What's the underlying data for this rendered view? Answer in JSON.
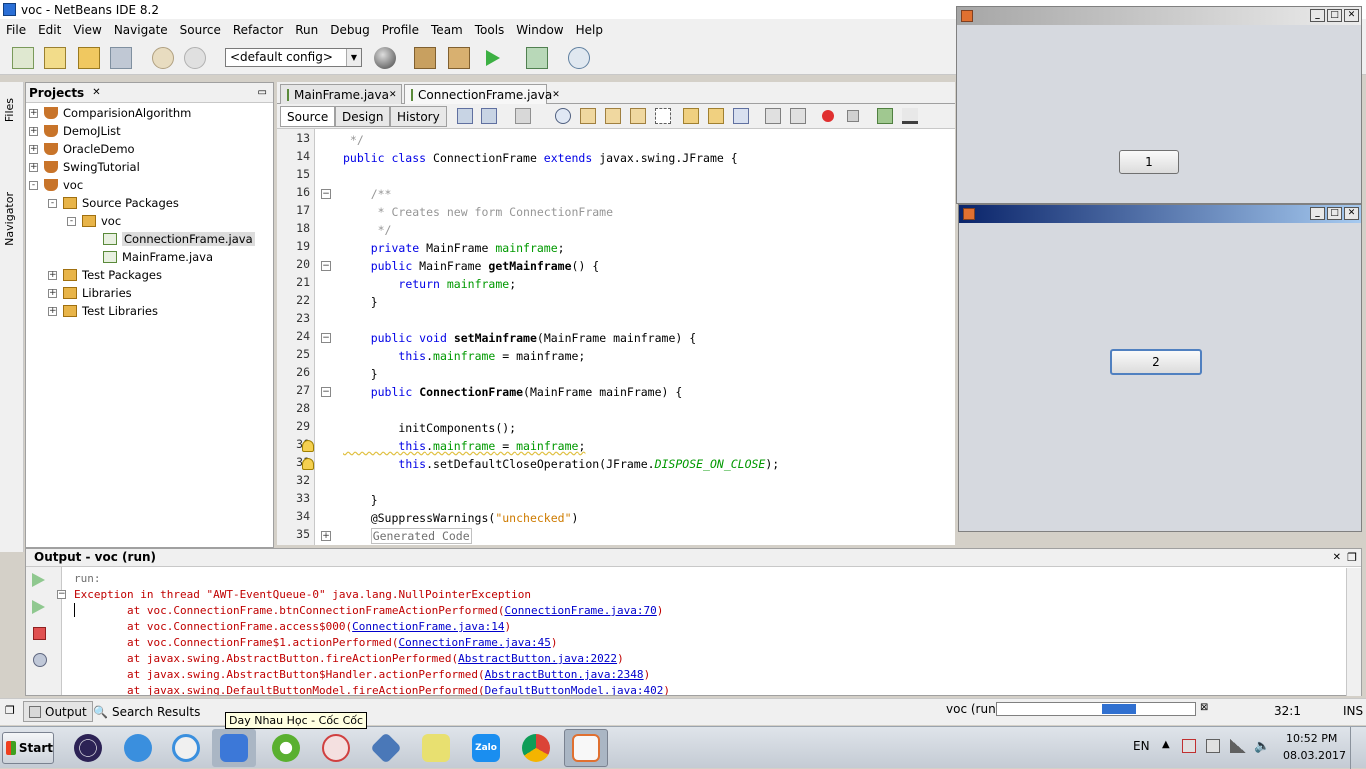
{
  "window": {
    "title": "voc - NetBeans IDE 8.2"
  },
  "menu": [
    "File",
    "Edit",
    "View",
    "Navigate",
    "Source",
    "Refactor",
    "Run",
    "Debug",
    "Profile",
    "Team",
    "Tools",
    "Window",
    "Help"
  ],
  "toolbar": {
    "config": "<default config>"
  },
  "side_tabs": {
    "files": "Files",
    "navigator": "Navigator"
  },
  "projects": {
    "title": "Projects",
    "items": [
      {
        "label": "ComparisionAlgorithm",
        "exp": "+"
      },
      {
        "label": "DemoJList",
        "exp": "+"
      },
      {
        "label": "OracleDemo",
        "exp": "+"
      },
      {
        "label": "SwingTutorial",
        "exp": "+"
      },
      {
        "label": "voc",
        "exp": "-"
      },
      {
        "label": "Source Packages",
        "exp": "-"
      },
      {
        "label": "voc",
        "exp": "-"
      },
      {
        "label": "ConnectionFrame.java",
        "exp": ""
      },
      {
        "label": "MainFrame.java",
        "exp": ""
      },
      {
        "label": "Test Packages",
        "exp": "+"
      },
      {
        "label": "Libraries",
        "exp": "+"
      },
      {
        "label": "Test Libraries",
        "exp": "+"
      }
    ]
  },
  "editor": {
    "tabs": [
      "MainFrame.java",
      "ConnectionFrame.java"
    ],
    "views": [
      "Source",
      "Design",
      "History"
    ],
    "line_numbers": [
      "13",
      "14",
      "15",
      "16",
      "17",
      "18",
      "19",
      "20",
      "21",
      "22",
      "23",
      "24",
      "25",
      "26",
      "27",
      "28",
      "29",
      "30",
      "31",
      "32",
      "33",
      "34",
      "35"
    ],
    "code": [
      " */",
      "public class ConnectionFrame extends javax.swing.JFrame {",
      "",
      "    /**",
      "     * Creates new form ConnectionFrame",
      "     */",
      "    private MainFrame mainframe;",
      "    public MainFrame getMainframe() {",
      "        return mainframe;",
      "    }",
      "",
      "    public void setMainframe(MainFrame mainframe) {",
      "        this.mainframe = mainframe;",
      "    }",
      "    public ConnectionFrame(MainFrame mainFrame) {",
      "",
      "        initComponents();",
      "        this.mainframe = mainframe;",
      "        this.setDefaultCloseOperation(JFrame.DISPOSE_ON_CLOSE);",
      "",
      "    }",
      "    @SuppressWarnings(\"unchecked\")",
      "    Generated Code"
    ]
  },
  "frames": {
    "button1": "1",
    "button2": "2"
  },
  "output": {
    "title": "Output - voc (run)",
    "run_label": "run:",
    "exception": "Exception in thread \"AWT-EventQueue-0\" java.lang.NullPointerException",
    "stack": [
      {
        "at": "        at voc.ConnectionFrame.btnConnectionFrameActionPerformed(",
        "link": "ConnectionFrame.java:70",
        "end": ")"
      },
      {
        "at": "        at voc.ConnectionFrame.access$000(",
        "link": "ConnectionFrame.java:14",
        "end": ")"
      },
      {
        "at": "        at voc.ConnectionFrame$1.actionPerformed(",
        "link": "ConnectionFrame.java:45",
        "end": ")"
      },
      {
        "at": "        at javax.swing.AbstractButton.fireActionPerformed(",
        "link": "AbstractButton.java:2022",
        "end": ")"
      },
      {
        "at": "        at javax.swing.AbstractButton$Handler.actionPerformed(",
        "link": "AbstractButton.java:2348",
        "end": ")"
      },
      {
        "at": "        at javax.swing.DefaultButtonModel.fireActionPerformed(",
        "link": "DefaultButtonModel.java:402",
        "end": ")"
      }
    ]
  },
  "status": {
    "output_tab": "Output",
    "search_tab": "Search Results",
    "run_label": "voc (run)",
    "position": "32:1",
    "mode": "INS",
    "progress": 0.17
  },
  "tooltip": "Day Nhau Học - Cốc Cốc",
  "taskbar": {
    "start": "Start",
    "lang": "EN",
    "time": "10:52 PM",
    "date": "08.03.2017"
  }
}
